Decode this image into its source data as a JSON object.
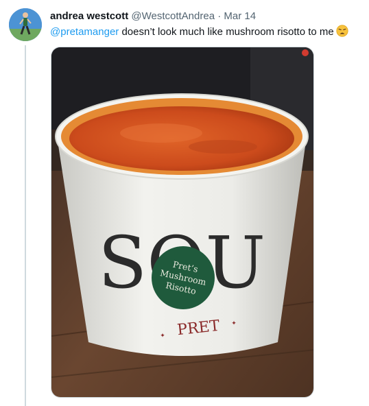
{
  "author": {
    "display_name": "andrea westcott",
    "handle": "@WestcottAndrea",
    "separator": "·",
    "date": "Mar 14"
  },
  "tweet": {
    "mention": "@pretamanger",
    "text": " doesn’t look much like mushroom risotto to me",
    "emoji": "weary-face-emoji"
  },
  "photo": {
    "cup_label_large": "SOU",
    "sticker_line1": "Pret’s",
    "sticker_line2": "Mushroom",
    "sticker_line3": "Risotto",
    "brand": "PRET",
    "colors": {
      "soup": "#d2521f",
      "sticker": "#1f5a3c",
      "brand": "#8a2a2a",
      "table": "#5e3d28"
    }
  }
}
